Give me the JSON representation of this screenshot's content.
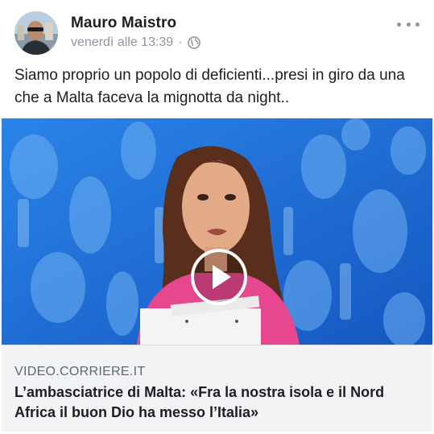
{
  "post": {
    "author": "Mauro Maistro",
    "timestamp": "venerdì alle 13:39",
    "separator": "·",
    "privacy_icon": "globe-icon",
    "more_icon": "more-options-icon",
    "text": "Siamo proprio un popolo di deficienti...presi in giro da una che a Malta faceva la mignotta da night.."
  },
  "video": {
    "play_icon": "play-icon",
    "background_color": "#1f6fd6"
  },
  "link_preview": {
    "domain": "VIDEO.CORRIERE.IT",
    "title": "L’ambasciatrice di Malta: «Fra la nostra isola e il Nord Africa il buon Dio ha messo l’Italia»"
  }
}
